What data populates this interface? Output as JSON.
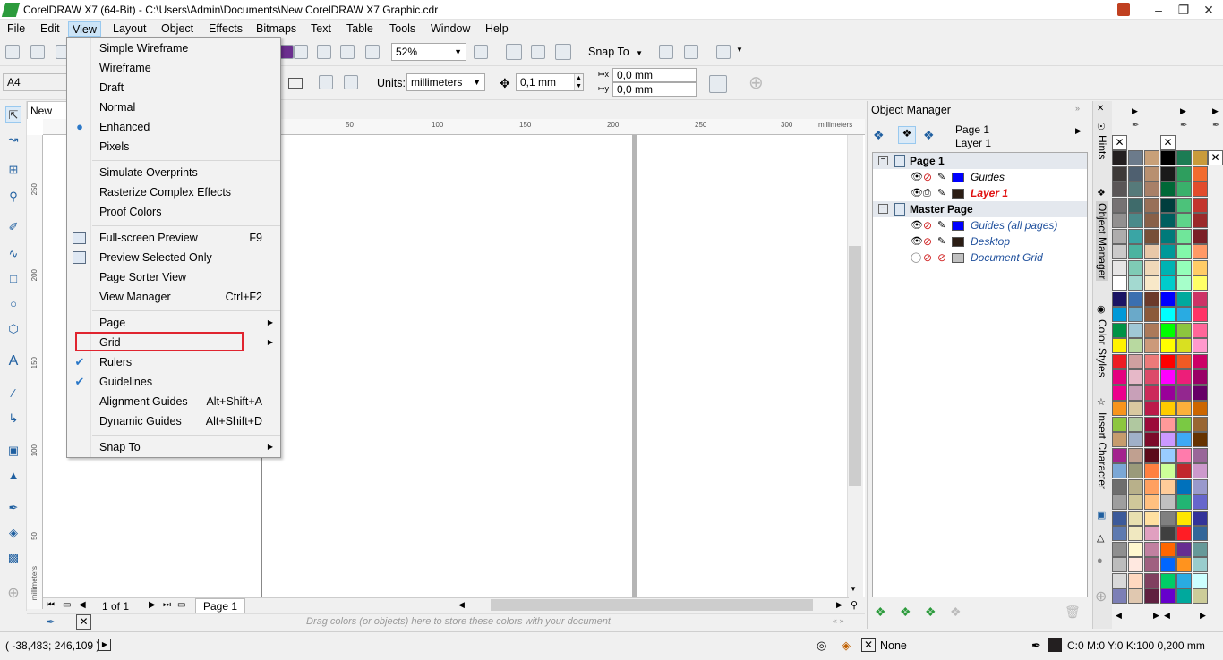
{
  "window": {
    "title": "CorelDRAW X7 (64-Bit) - C:\\Users\\Admin\\Documents\\New CorelDRAW X7 Graphic.cdr"
  },
  "menubar": [
    "File",
    "Edit",
    "View",
    "Layout",
    "Object",
    "Effects",
    "Bitmaps",
    "Text",
    "Table",
    "Tools",
    "Window",
    "Help"
  ],
  "toolbar": {
    "zoom": "52%",
    "snap_to": "Snap To"
  },
  "propbar": {
    "page_size": "A4",
    "units_label": "Units:",
    "units": "millimeters",
    "nudge": "0,1 mm",
    "dup_x": "0,0 mm",
    "dup_y": "0,0 mm"
  },
  "doc_tab": "New Co",
  "ruler": {
    "h_ticks": [
      "50",
      "100",
      "150",
      "200",
      "250",
      "300"
    ],
    "h_unit": "millimeters",
    "v_ticks": [
      "250",
      "200",
      "150",
      "100",
      "50"
    ],
    "v_unit": "millimeters"
  },
  "view_menu": {
    "groups": [
      [
        {
          "label": "Simple Wireframe"
        },
        {
          "label": "Wireframe"
        },
        {
          "label": "Draft"
        },
        {
          "label": "Normal"
        },
        {
          "label": "Enhanced",
          "mark": "dot"
        },
        {
          "label": "Pixels"
        }
      ],
      [
        {
          "label": "Simulate Overprints"
        },
        {
          "label": "Rasterize Complex Effects"
        },
        {
          "label": "Proof Colors"
        }
      ],
      [
        {
          "label": "Full-screen Preview",
          "shortcut": "F9",
          "icon": "fullscreen-icon"
        },
        {
          "label": "Preview Selected Only",
          "icon": "preview-selected-icon"
        },
        {
          "label": "Page Sorter View"
        },
        {
          "label": "View Manager",
          "shortcut": "Ctrl+F2"
        }
      ],
      [
        {
          "label": "Page",
          "submenu": true
        },
        {
          "label": "Grid",
          "submenu": true
        },
        {
          "label": "Rulers",
          "mark": "check"
        },
        {
          "label": "Guidelines",
          "mark": "check"
        },
        {
          "label": "Alignment Guides",
          "shortcut": "Alt+Shift+A"
        },
        {
          "label": "Dynamic Guides",
          "shortcut": "Alt+Shift+D"
        }
      ],
      [
        {
          "label": "Snap To",
          "submenu": true
        }
      ]
    ]
  },
  "page_nav": {
    "counter": "1 of 1",
    "tab": "Page 1"
  },
  "color_tray": {
    "hint": "Drag colors (or objects) here to store these colors with your document"
  },
  "status": {
    "coords": "( -38,483; 246,109 )",
    "fill": "None",
    "outline": "C:0 M:0 Y:0 K:100  0,200 mm"
  },
  "object_manager": {
    "title": "Object Manager",
    "page": "Page 1",
    "layer": "Layer 1",
    "rows": [
      {
        "label": "Page 1",
        "group": true
      },
      {
        "label": "Guides",
        "color": "#0000ff"
      },
      {
        "label": "Layer 1",
        "color": "#2b1d14",
        "active": true
      },
      {
        "label": "Master Page",
        "group": true
      },
      {
        "label": "Guides (all pages)",
        "color": "#0000ff",
        "italic": true
      },
      {
        "label": "Desktop",
        "color": "#2b1d14",
        "italic": true
      },
      {
        "label": "Document Grid",
        "color": "#c0c0c0",
        "italic": true
      }
    ]
  },
  "side_tabs": [
    "Hints",
    "Object Manager",
    "Color Styles",
    "Insert Character"
  ],
  "palette_colors": {
    "col1": [
      "#231f20",
      "#3e3a39",
      "#5a5657",
      "#767273",
      "#929090",
      "#aeacac",
      "#cbcaca",
      "#e6e5e5",
      "#ffffff",
      "#1b1464",
      "#0099d8",
      "#009245",
      "#fff200",
      "#ed1c24",
      "#e4007f",
      "#ec008c",
      "#f7941d",
      "#8dc63f",
      "#c69c6d",
      "#a3228e",
      "#7ba7d6",
      "#6e6e6e",
      "#9e9e9e",
      "#3c5a9a",
      "#5e7ab0",
      "#8f8f8f",
      "#bcbcbc",
      "#d9d9d9",
      "#7c7fb6"
    ],
    "col2": [
      "#6c7b8b",
      "#4f6070",
      "#567a7a",
      "#3f6b6b",
      "#4a8a8a",
      "#3aa5a5",
      "#4bb3a0",
      "#7fcbb5",
      "#a3d9d0",
      "#3b6fb0",
      "#6aa9c9",
      "#a0c8d6",
      "#b8d9a0",
      "#d0a0a0",
      "#e6b8c8",
      "#c8a0b8",
      "#d9c8a0",
      "#b0c8a0",
      "#a0b0c8",
      "#c0a090",
      "#9a9a7a",
      "#b8b08a",
      "#d0c89a",
      "#e8e0b0",
      "#f0e8c0",
      "#fff8d0",
      "#ffe8e0",
      "#ffd8c0",
      "#e0c8b0"
    ],
    "col3": [
      "#c8a078",
      "#b89070",
      "#a88068",
      "#987058",
      "#886048",
      "#785038",
      "#e8c8a8",
      "#f0d8b8",
      "#f8e8c8",
      "#6c3a2a",
      "#8c5a3a",
      "#ac7a5a",
      "#cc9a7a",
      "#ec7a7a",
      "#dc4a6a",
      "#cc2a5a",
      "#bc1a4a",
      "#9c0a3a",
      "#7c0a2a",
      "#5c0a1a",
      "#ff8040",
      "#ffa060",
      "#ffc080",
      "#ffe0a0",
      "#e0a0c0",
      "#c080a0",
      "#a06080",
      "#804060",
      "#602040"
    ],
    "col4": [
      "#000000",
      "#1a1a1a",
      "#006837",
      "#003d3d",
      "#005e5e",
      "#007a7a",
      "#009999",
      "#00b3b3",
      "#00cccc",
      "#0000ff",
      "#00ffff",
      "#00ff00",
      "#ffff00",
      "#ff0000",
      "#ff00ff",
      "#990099",
      "#ffcc00",
      "#ff9999",
      "#cc99ff",
      "#99ccff",
      "#ccff99",
      "#ffcc99",
      "#c0c0c0",
      "#808080",
      "#404040",
      "#ff6600",
      "#0066ff",
      "#00cc66",
      "#6600cc"
    ],
    "col5": [
      "#1c7c54",
      "#2e9e5e",
      "#3ab06b",
      "#4cc27a",
      "#5ed48a",
      "#70e69a",
      "#82f8aa",
      "#94ffba",
      "#a6ffca",
      "#00a99d",
      "#29abe2",
      "#8cc63f",
      "#d9e021",
      "#f15a24",
      "#ed1e79",
      "#93278f",
      "#fbb03b",
      "#7ac943",
      "#3fa9f5",
      "#ff7bac",
      "#c1272d",
      "#0071bc",
      "#22b573",
      "#ffe600",
      "#ff1d25",
      "#662d91",
      "#ff931e",
      "#29abe2",
      "#00a99d"
    ],
    "col6": [
      "#c99b3b",
      "#f26b2e",
      "#e24c2c",
      "#c3352d",
      "#9b2a2a",
      "#7a1f26",
      "#ff9966",
      "#ffcc66",
      "#ffff66",
      "#cc3366",
      "#ff3366",
      "#ff6699",
      "#ff99cc",
      "#cc0066",
      "#990066",
      "#660066",
      "#cc6600",
      "#996633",
      "#663300",
      "#996699",
      "#cc99cc",
      "#9999cc",
      "#6666cc",
      "#333399",
      "#336699",
      "#669999",
      "#99cccc",
      "#ccffff",
      "#cccc99"
    ]
  }
}
